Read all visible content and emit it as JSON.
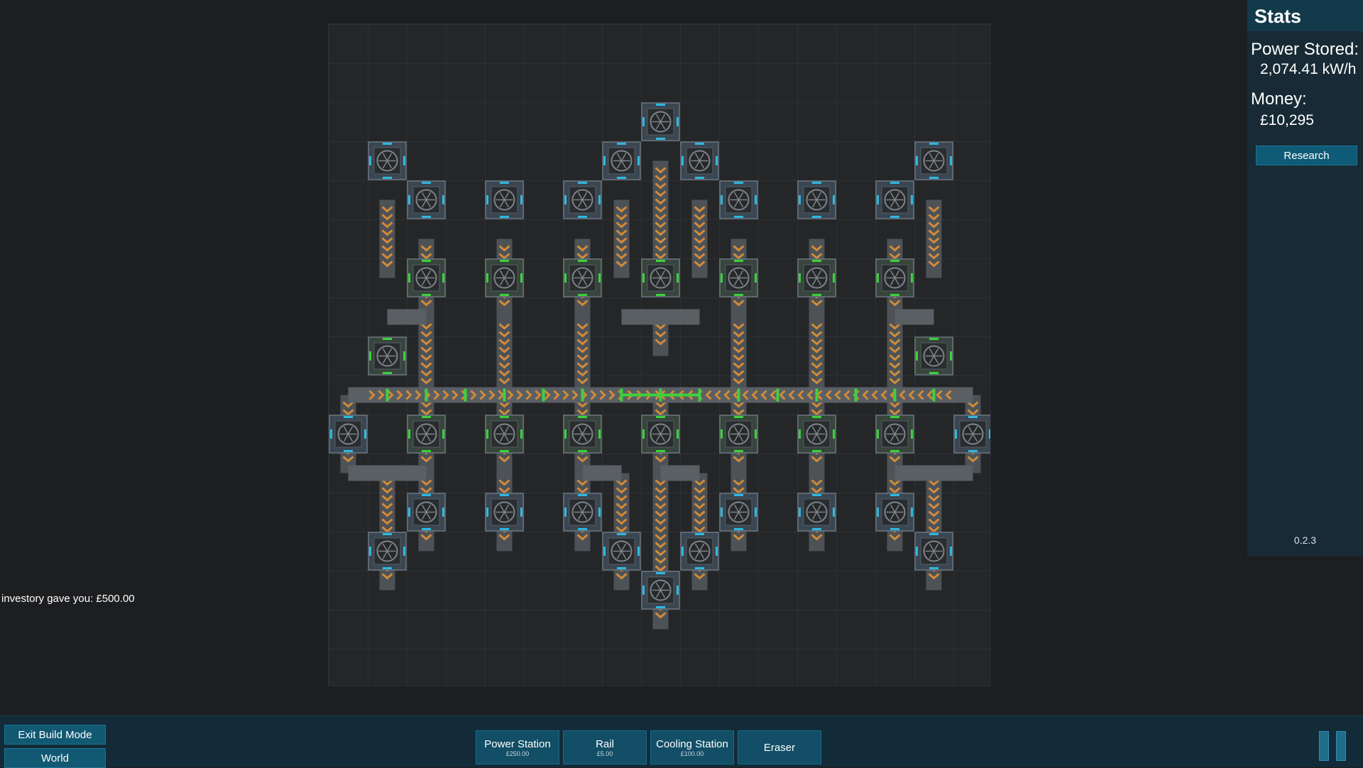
{
  "stats": {
    "title": "Stats",
    "power_label": "Power Stored:",
    "power_value": "2,074.41 kW/h",
    "money_label": "Money:",
    "money_value": "£10,295",
    "research_label": "Research",
    "version": "0.2.3"
  },
  "message": "investory gave you: £500.00",
  "left_buttons": {
    "exit_build": "Exit Build Mode",
    "world": "World"
  },
  "tools": [
    {
      "name": "Power Station",
      "cost": "£250.00"
    },
    {
      "name": "Rail",
      "cost": "£5.00"
    },
    {
      "name": "Cooling Station",
      "cost": "£100.00"
    },
    {
      "name": "Eraser",
      "cost": ""
    }
  ],
  "colors": {
    "panel": "#182a35",
    "button": "#115873",
    "rail_arrow": "#d18a3a",
    "connector_active": "#3cd13c",
    "connector_idle": "#2fb8e0"
  },
  "icons": {
    "station": "turbine-fan-icon",
    "pause": "pause-icon"
  }
}
